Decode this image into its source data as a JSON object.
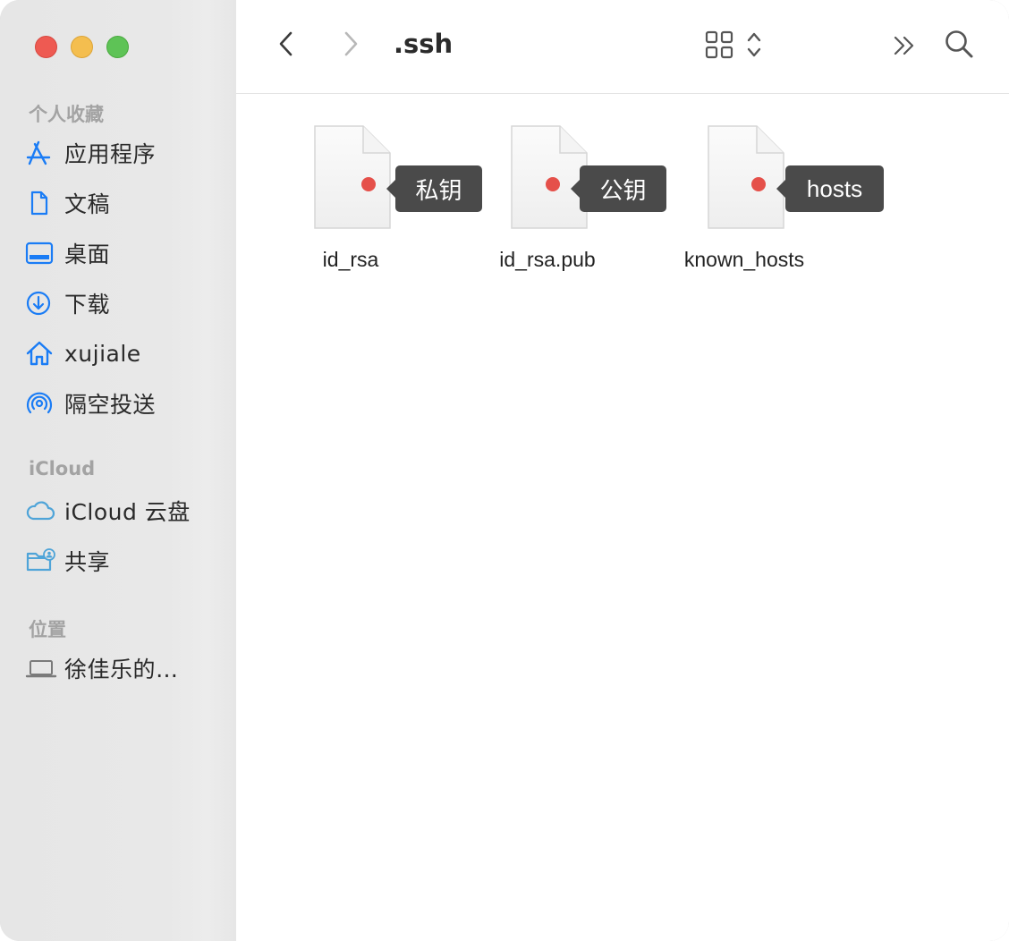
{
  "window": {
    "controls": [
      "close",
      "minimize",
      "maximize"
    ]
  },
  "toolbar": {
    "back_icon": "chevron-left-icon",
    "forward_icon": "chevron-right-icon",
    "title": ".ssh",
    "view_icon": "grid-view-icon",
    "sort_icon": "up-down-chevron-icon",
    "more_icon": "double-chevron-right-icon",
    "search_icon": "search-icon"
  },
  "sidebar": {
    "favorites_title": "个人收藏",
    "favorites": [
      {
        "label": "应用程序",
        "icon": "applications-icon"
      },
      {
        "label": "文稿",
        "icon": "document-icon"
      },
      {
        "label": "桌面",
        "icon": "desktop-icon"
      },
      {
        "label": "下载",
        "icon": "download-icon"
      },
      {
        "label": "xujiale",
        "icon": "home-icon"
      },
      {
        "label": "隔空投送",
        "icon": "airdrop-icon"
      }
    ],
    "icloud_title": "iCloud",
    "icloud": [
      {
        "label": "iCloud 云盘",
        "icon": "cloud-icon"
      },
      {
        "label": "共享",
        "icon": "shared-folder-icon"
      }
    ],
    "locations_title": "位置",
    "locations": [
      {
        "label": "徐佳乐的…",
        "icon": "laptop-icon"
      }
    ]
  },
  "files": [
    {
      "name": "id_rsa",
      "tag": "私钥"
    },
    {
      "name": "id_rsa.pub",
      "tag": "公钥"
    },
    {
      "name": "known_hosts",
      "tag": "hosts"
    }
  ],
  "colors": {
    "accent": "#1a7cf5",
    "tag_bg": "#4a4a4a",
    "tag_dot": "#e5504a"
  }
}
